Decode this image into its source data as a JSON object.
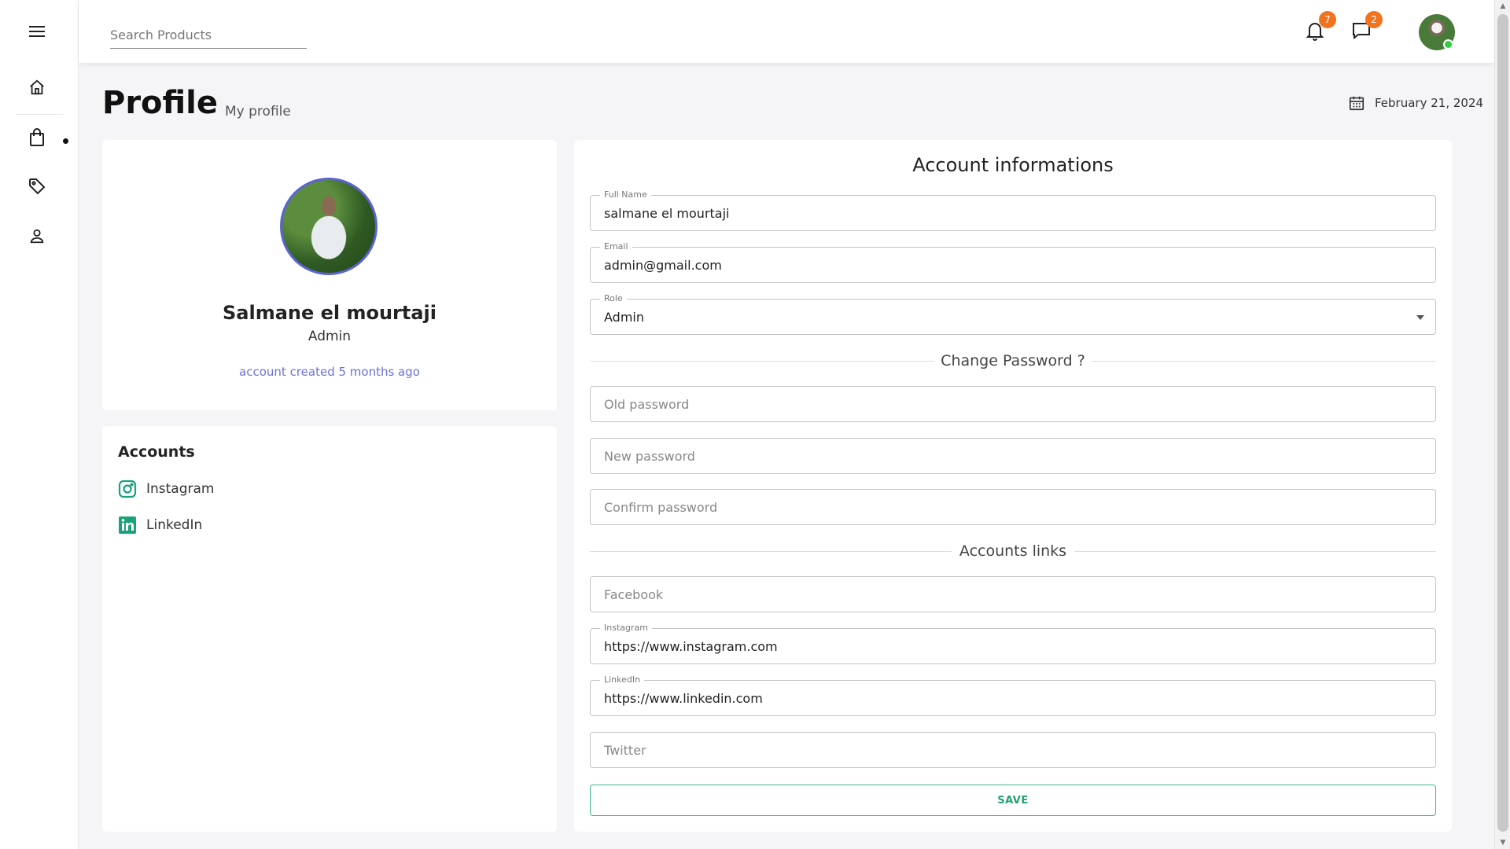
{
  "colors": {
    "accent_purple": "#6b72d6",
    "badge_orange": "#f07320",
    "save_green": "#22a36f",
    "online_green": "#2ecc40",
    "linkedin_teal": "#1aa37a"
  },
  "sidebar": {
    "items": [
      {
        "icon": "menu-icon"
      },
      {
        "icon": "home-icon"
      },
      {
        "icon": "shopping-bag-icon"
      },
      {
        "icon": "tag-icon"
      },
      {
        "icon": "user-icon"
      }
    ]
  },
  "topbar": {
    "search_placeholder": "Search Products",
    "notifications_count": "7",
    "messages_count": "2"
  },
  "header": {
    "title": "Profile",
    "subtitle": "My profile",
    "date": "February 21, 2024"
  },
  "profile": {
    "name": "Salmane el mourtaji",
    "role": "Admin",
    "created": "account created 5 months ago"
  },
  "accounts": {
    "title": "Accounts",
    "items": [
      {
        "label": "Instagram",
        "icon": "instagram-icon"
      },
      {
        "label": "LinkedIn",
        "icon": "linkedin-icon"
      }
    ]
  },
  "form": {
    "title": "Account informations",
    "full_name_label": "Full Name",
    "full_name_value": "salmane el mourtaji",
    "email_label": "Email",
    "email_value": "admin@gmail.com",
    "role_label": "Role",
    "role_value": "Admin",
    "password_section": "Change Password ?",
    "old_password_placeholder": "Old password",
    "new_password_placeholder": "New password",
    "confirm_password_placeholder": "Confirm password",
    "links_section": "Accounts links",
    "facebook_placeholder": "Facebook",
    "instagram_label": "Instagram",
    "instagram_value": "https://www.instagram.com",
    "linkedin_label": "LinkedIn",
    "linkedin_value": "https://www.linkedin.com",
    "twitter_placeholder": "Twitter",
    "save_label": "SAVE"
  }
}
